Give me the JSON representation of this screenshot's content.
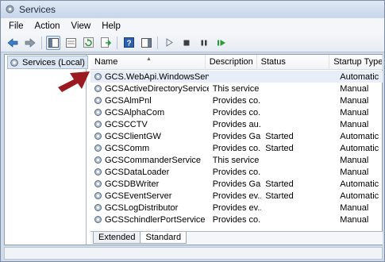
{
  "window": {
    "title": "Services"
  },
  "menu": [
    "File",
    "Action",
    "View",
    "Help"
  ],
  "toolbar": {
    "buttons": [
      "back-icon",
      "forward-icon",
      "show-hide-tree-icon",
      "properties-icon",
      "refresh-icon",
      "export-list-icon",
      "help-icon",
      "show-hide-action-pane-icon",
      "start-service-icon",
      "stop-service-icon",
      "pause-service-icon",
      "restart-service-icon"
    ]
  },
  "tree": {
    "root_label": "Services (Local)"
  },
  "list": {
    "columns": [
      "Name",
      "Description",
      "Status",
      "Startup Type"
    ],
    "rows": [
      {
        "name": "GCS.WebApi.WindowsService",
        "description": "",
        "status": "",
        "startup": "Automatic"
      },
      {
        "name": "GCSActiveDirectoryService",
        "description": "This service ...",
        "status": "",
        "startup": "Manual"
      },
      {
        "name": "GCSAlmPnl",
        "description": "Provides co...",
        "status": "",
        "startup": "Manual"
      },
      {
        "name": "GCSAlphaCom",
        "description": "Provides co...",
        "status": "",
        "startup": "Manual"
      },
      {
        "name": "GCSCCTV",
        "description": "Provides au...",
        "status": "",
        "startup": "Manual"
      },
      {
        "name": "GCSClientGW",
        "description": "Provides Ga...",
        "status": "Started",
        "startup": "Automatic"
      },
      {
        "name": "GCSComm",
        "description": "Provides co...",
        "status": "Started",
        "startup": "Automatic"
      },
      {
        "name": "GCSCommanderService",
        "description": "This service ...",
        "status": "",
        "startup": "Manual"
      },
      {
        "name": "GCSDataLoader",
        "description": "Provides co...",
        "status": "",
        "startup": "Manual"
      },
      {
        "name": "GCSDBWriter",
        "description": "Provides Ga...",
        "status": "Started",
        "startup": "Automatic"
      },
      {
        "name": "GCSEventServer",
        "description": "Provides ev...",
        "status": "Started",
        "startup": "Automatic"
      },
      {
        "name": "GCSLogDistributor",
        "description": "Provides ev...",
        "status": "",
        "startup": "Manual"
      },
      {
        "name": "GCSSchindlerPortService",
        "description": "Provides co...",
        "status": "",
        "startup": "Manual"
      }
    ]
  },
  "tabs": [
    "Extended",
    "Standard"
  ],
  "colors": {
    "annotation_arrow": "#9b1a22",
    "selection": "#e8eef7"
  }
}
